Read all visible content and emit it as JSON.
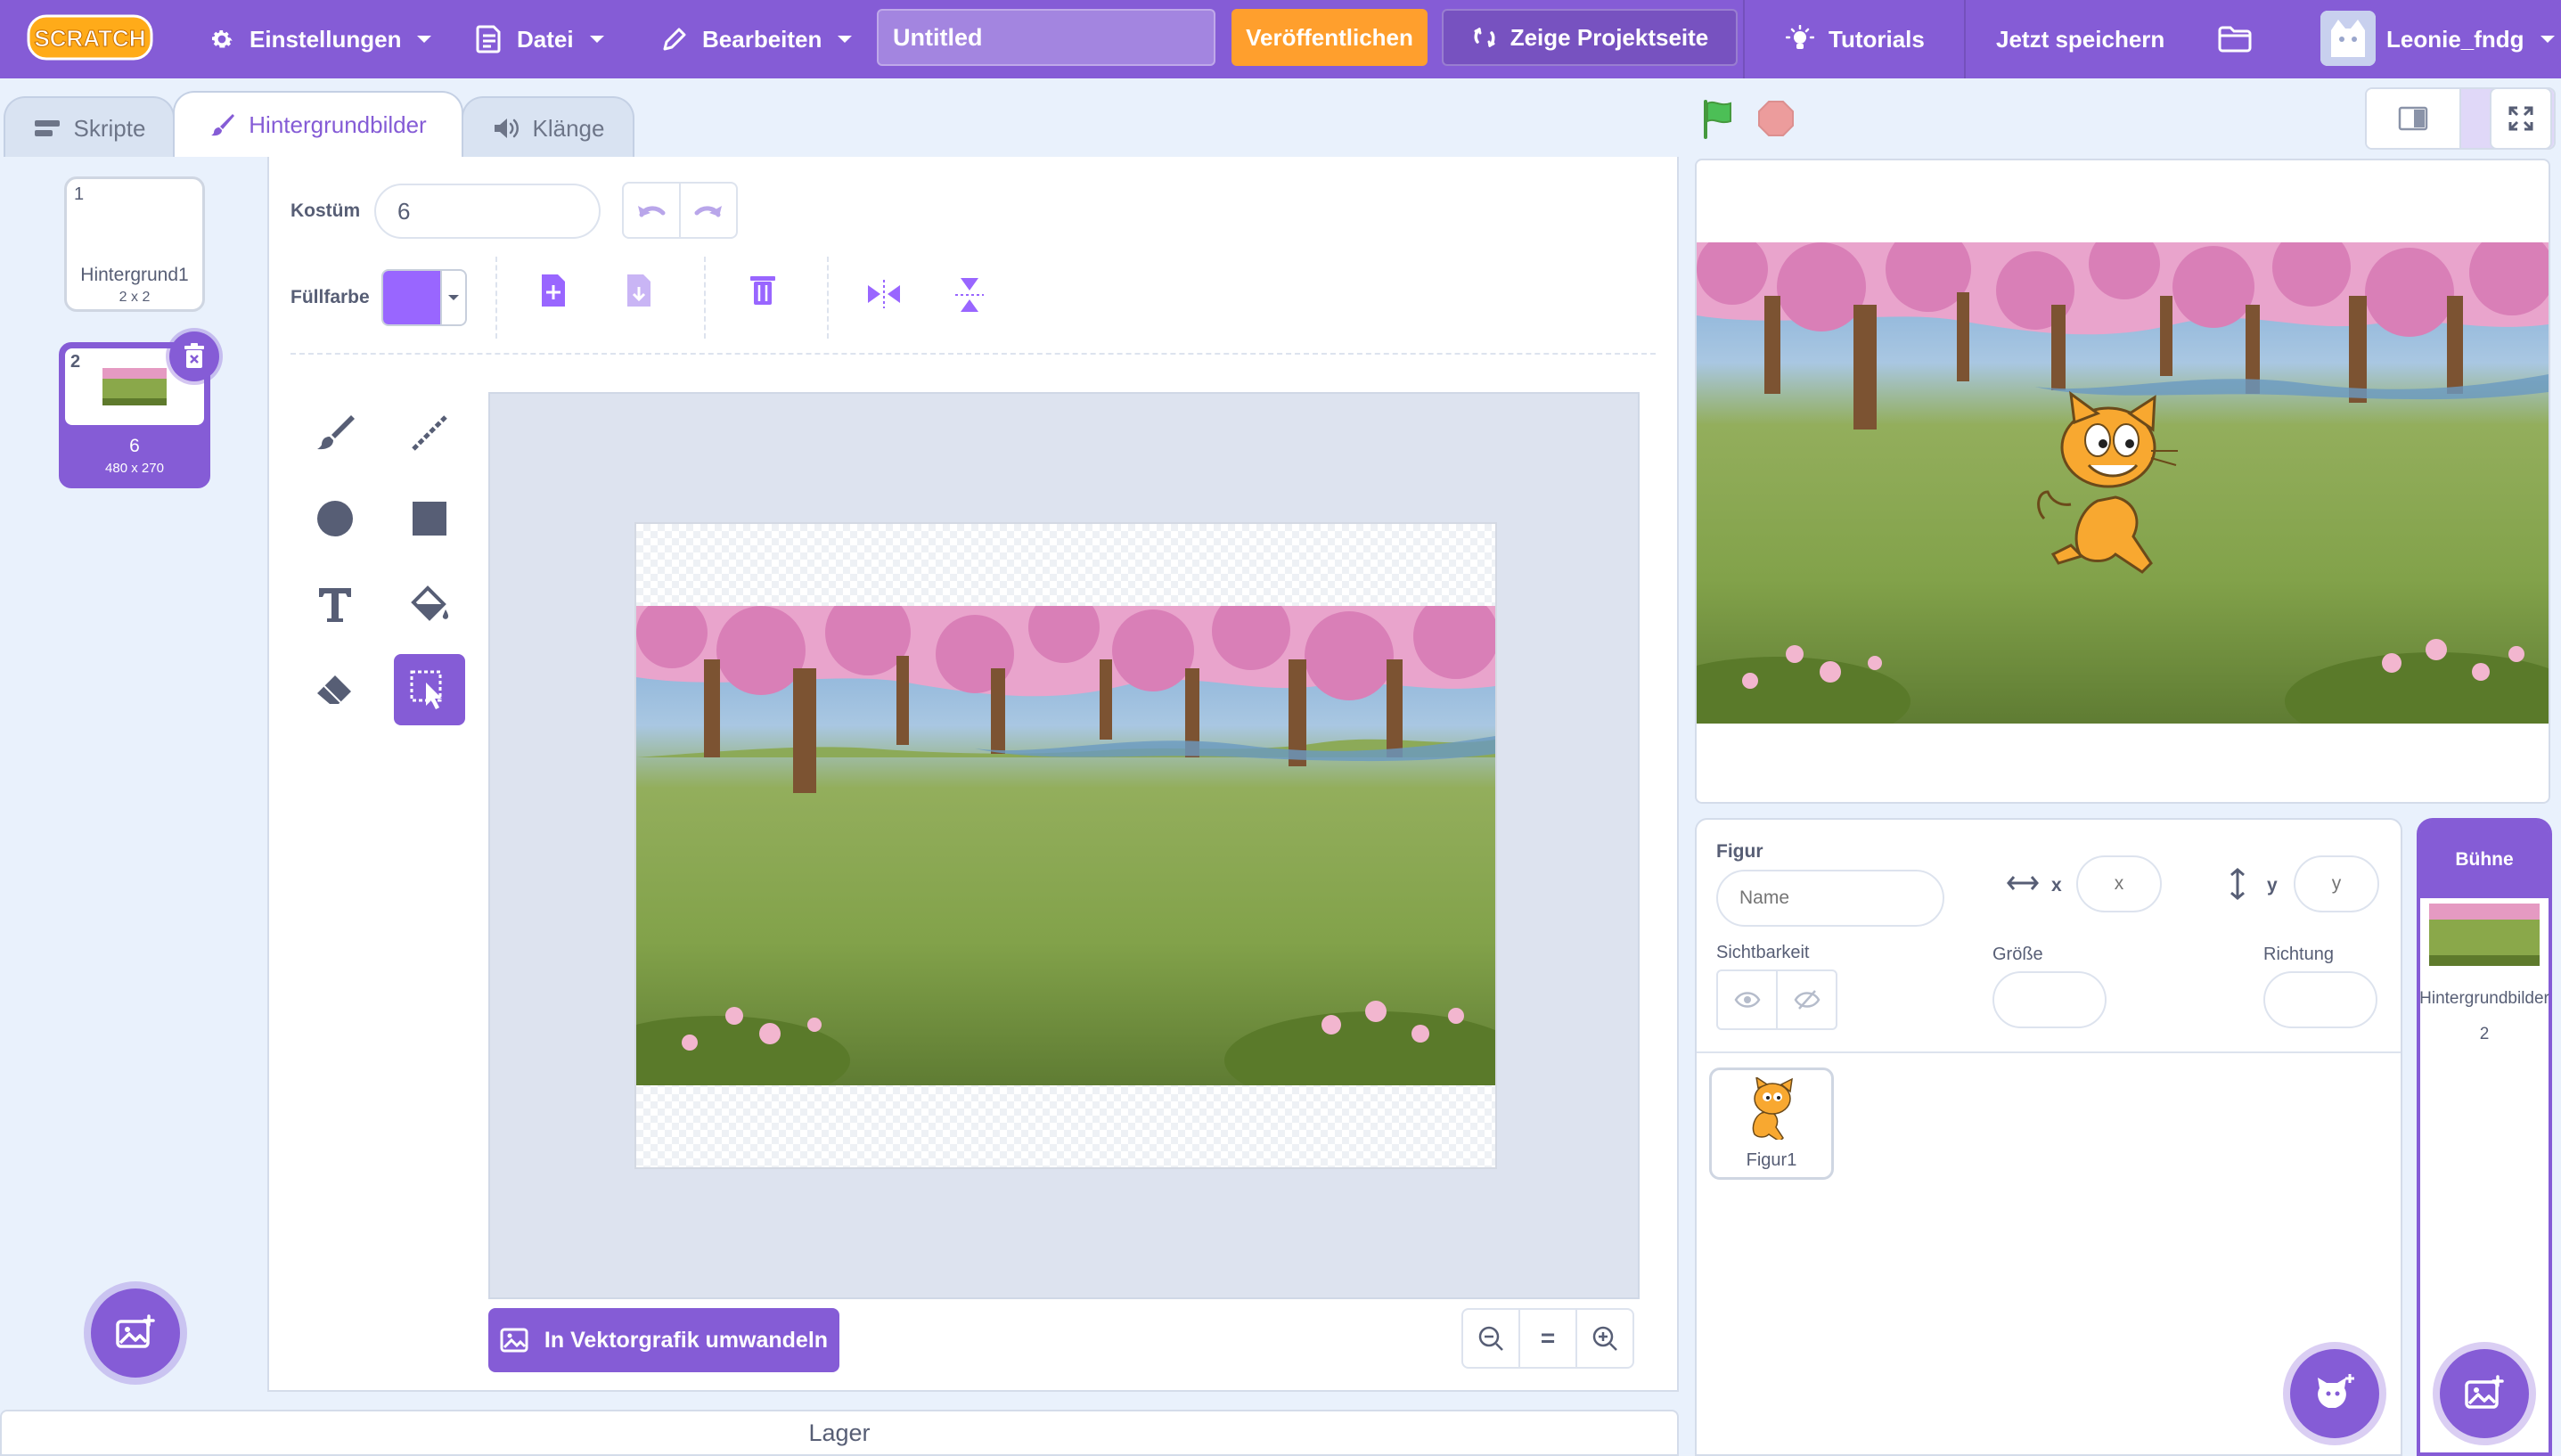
{
  "menubar": {
    "logo_text": "SCRATCH",
    "settings_label": "Einstellungen",
    "file_label": "Datei",
    "edit_label": "Bearbeiten",
    "project_title": "Untitled",
    "publish_label": "Veröffentlichen",
    "project_page_label": "Zeige Projektseite",
    "tutorials_label": "Tutorials",
    "save_now_label": "Jetzt speichern",
    "username": "Leonie_fndg"
  },
  "tabs": [
    {
      "label": "Skripte",
      "icon": "code-icon"
    },
    {
      "label": "Hintergrundbilder",
      "icon": "paintbrush-icon",
      "active": true
    },
    {
      "label": "Klänge",
      "icon": "speaker-icon"
    }
  ],
  "costumes": [
    {
      "index": "1",
      "name": "Hintergrund1",
      "size": "2 x 2",
      "selected": false
    },
    {
      "index": "2",
      "name": "6",
      "size": "480 x 270",
      "selected": true
    }
  ],
  "paint_editor": {
    "costume_label": "Kostüm",
    "costume_name": "6",
    "fill_label": "Füllfarbe",
    "fill_color": "#9966ff",
    "convert_button": "In Vektorgrafik umwandeln",
    "zoom_reset_label": "="
  },
  "bottom": {
    "backpack_label": "Lager"
  },
  "sprite_info": {
    "sprite_label": "Figur",
    "name_placeholder": "Name",
    "x_label": "x",
    "x_placeholder": "x",
    "y_label": "y",
    "y_placeholder": "y",
    "visibility_label": "Sichtbarkeit",
    "size_label": "Größe",
    "direction_label": "Richtung"
  },
  "sprites": [
    {
      "name": "Figur1"
    }
  ],
  "stage_pane": {
    "header": "Bühne",
    "backdrops_label": "Hintergrundbilder",
    "backdrops_count": "2"
  },
  "colors": {
    "menu_bg": "#855cd6",
    "accent": "#855cd6",
    "publish": "#ff9f2d",
    "green_flag": "#4cbf56",
    "stop": "#ec9c9c"
  }
}
